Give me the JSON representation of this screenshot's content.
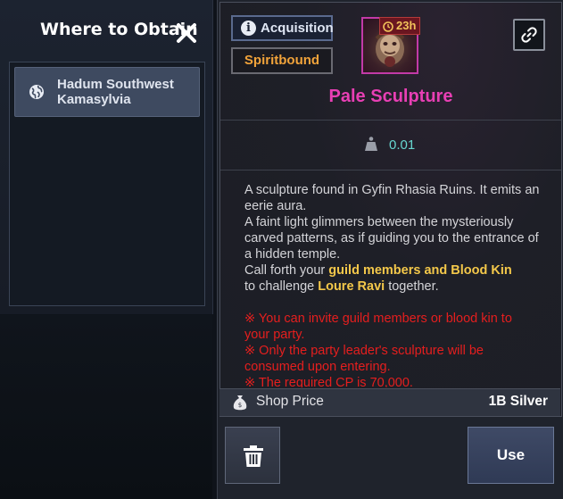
{
  "where_to_obtain": {
    "title": "Where to Obtain",
    "locations": [
      {
        "label": "Hadum Southwest Kamasylvia",
        "icon": "globe-icon"
      }
    ]
  },
  "item": {
    "acquisition_label": "Acquisition",
    "binding_label": "Spiritbound",
    "timer": "23h",
    "name": "Pale Sculpture",
    "name_color": "#e83fb4",
    "weight": "0.01",
    "description": {
      "line1": "A sculpture found in Gyfin Rhasia Ruins. It emits an eerie aura.",
      "line2": "A faint light glimmers between the mysteriously carved patterns, as if guiding you to the entrance of a hidden temple.",
      "line3_prefix": "Call forth your ",
      "line3_highlight": "guild members and Blood Kin",
      "line4_prefix": "to challenge ",
      "line4_highlight": "Loure Ravi",
      "line4_suffix": " together.",
      "warn1": "※ You can invite guild members or blood kin to your party.",
      "warn2": "※ Only the party leader's sculpture will be consumed upon entering.",
      "warn3": "※ The required CP is 70,000."
    },
    "shop_price_label": "Shop Price",
    "shop_price_value": "1B Silver"
  },
  "actions": {
    "use_label": "Use"
  },
  "colors": {
    "highlight": "#f4c84a",
    "warning": "#e51e1e",
    "weight": "#67d6d0",
    "spiritbound": "#f1a33a"
  }
}
